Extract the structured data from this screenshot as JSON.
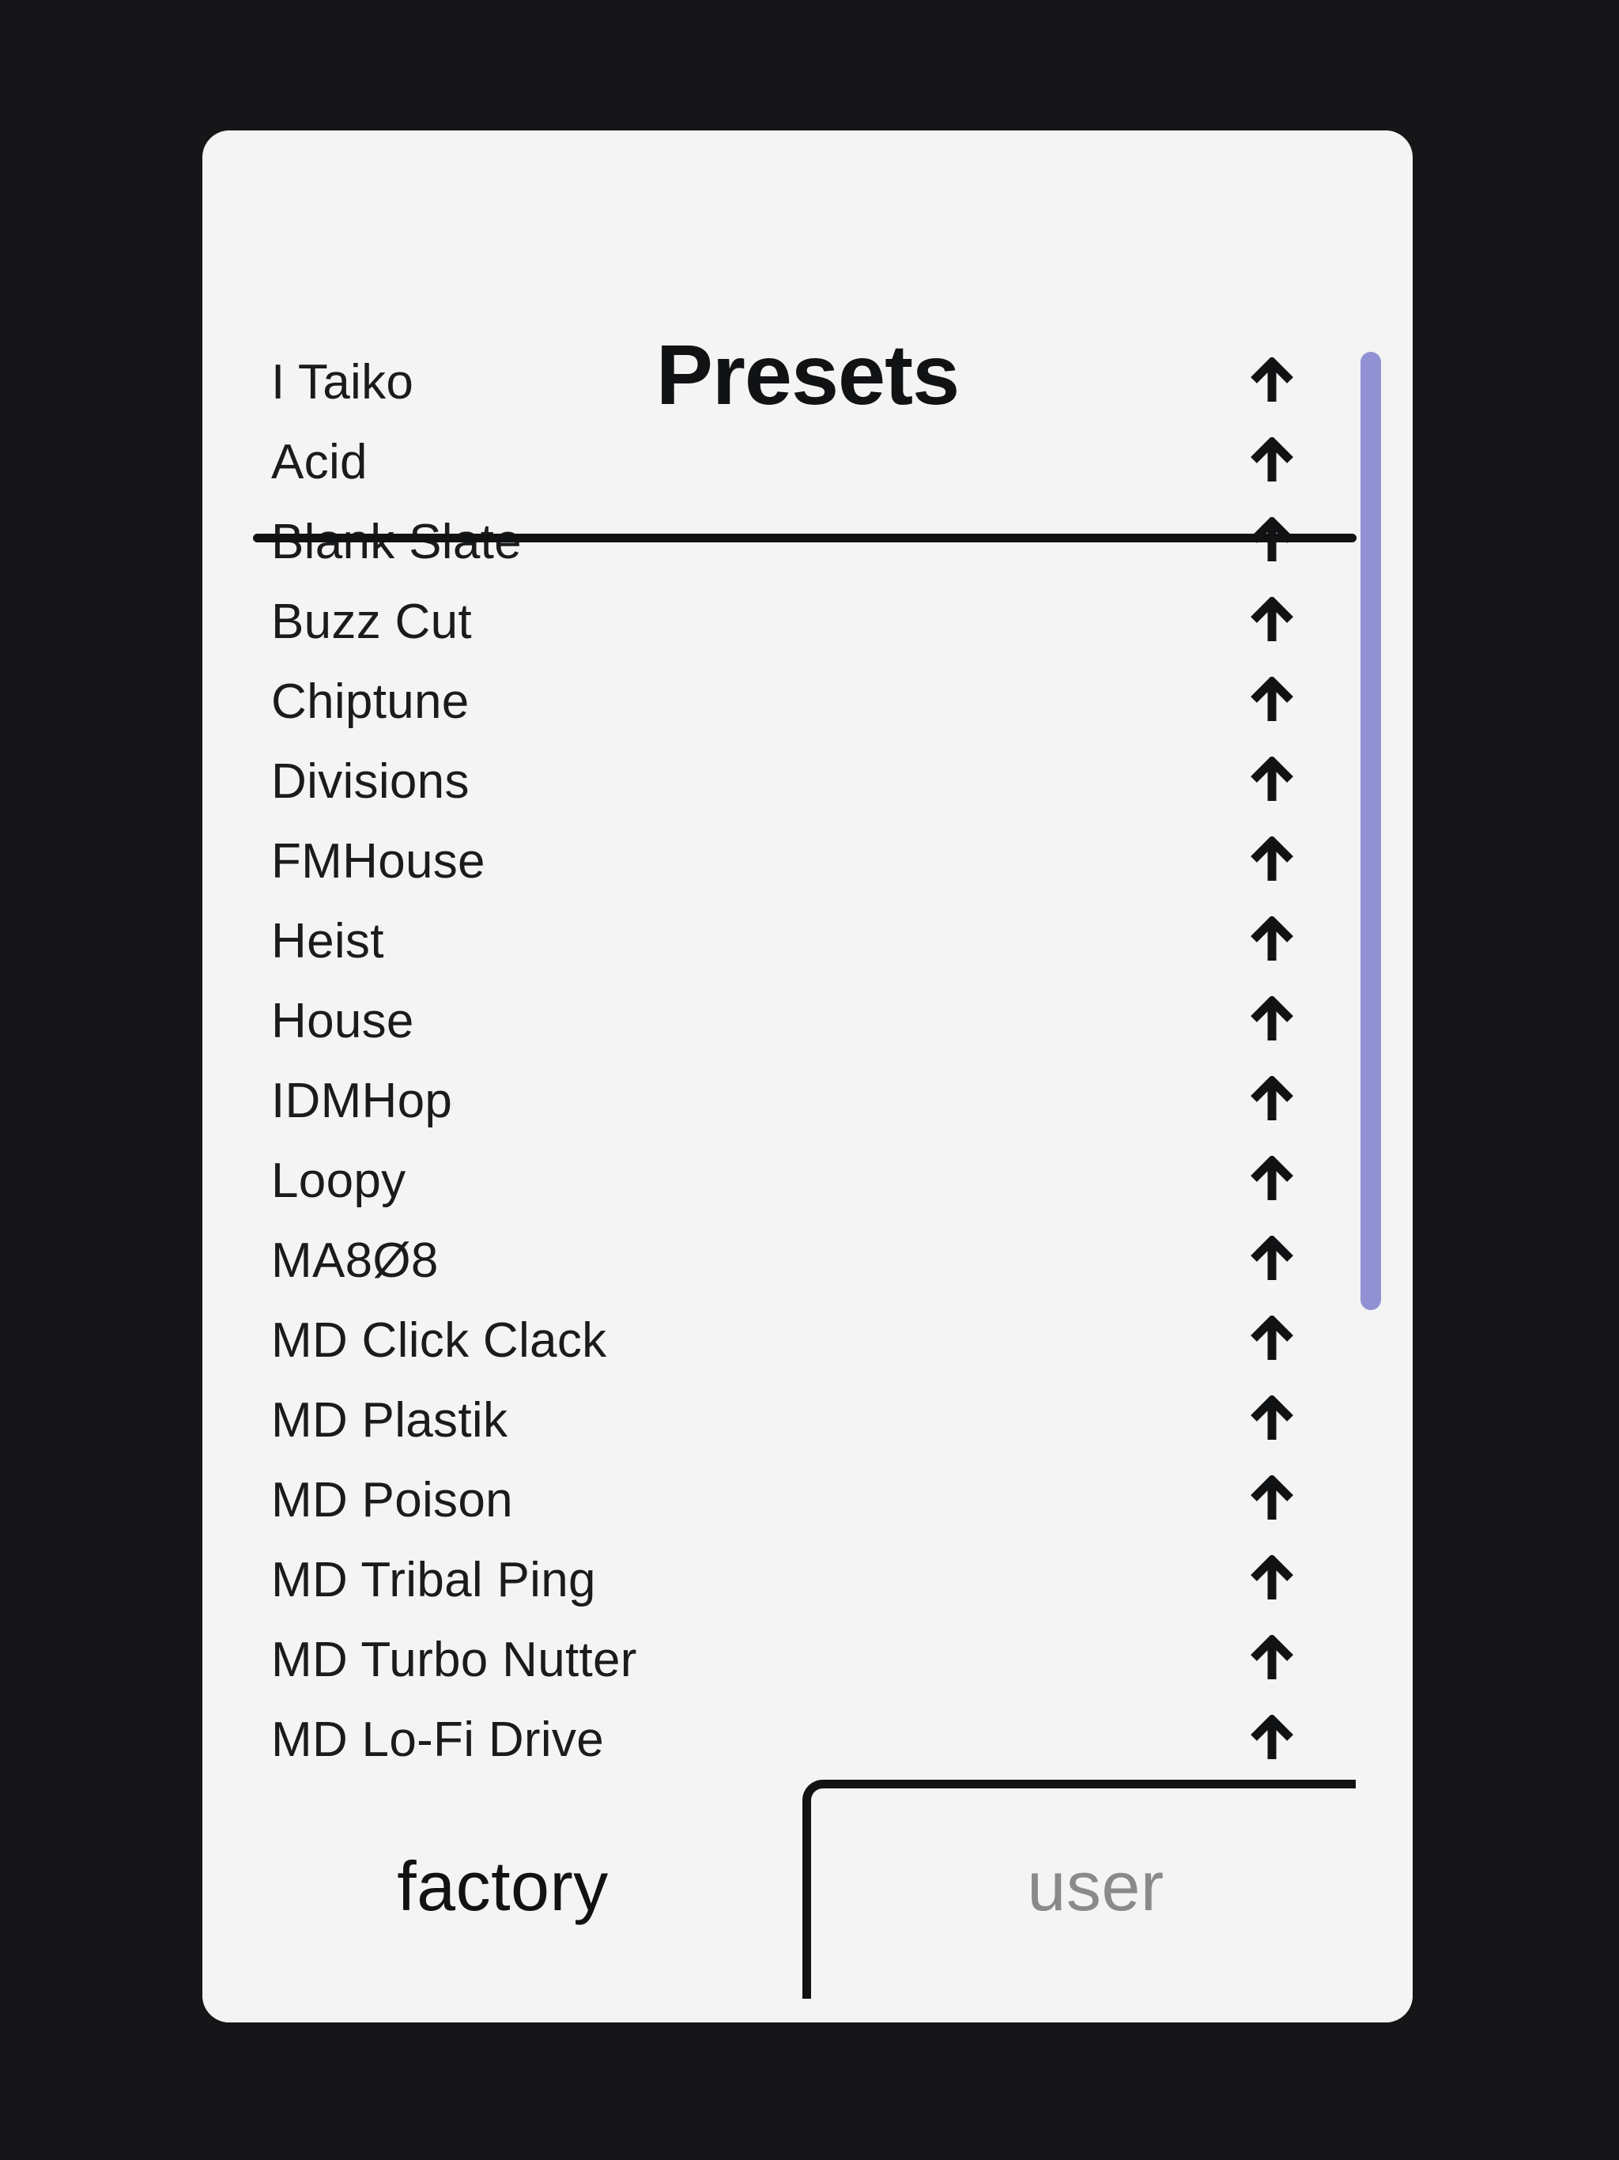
{
  "panel": {
    "title": "Presets",
    "background_color": "#f4f4f5",
    "page_background_color": "#161618"
  },
  "list": {
    "row_action_icon": "up-arrow-icon",
    "items": [
      {
        "name": "I Taiko"
      },
      {
        "name": "Acid"
      },
      {
        "name": "Blank Slate"
      },
      {
        "name": "Buzz Cut"
      },
      {
        "name": "Chiptune"
      },
      {
        "name": "Divisions"
      },
      {
        "name": "FMHouse"
      },
      {
        "name": "Heist"
      },
      {
        "name": "House"
      },
      {
        "name": "IDMHop"
      },
      {
        "name": "Loopy"
      },
      {
        "name": "MA8Ø8"
      },
      {
        "name": "MD Click Clack"
      },
      {
        "name": "MD Plastik"
      },
      {
        "name": "MD Poison"
      },
      {
        "name": "MD Tribal Ping"
      },
      {
        "name": "MD Turbo Nutter"
      },
      {
        "name": "MD Lo-Fi Drive"
      }
    ]
  },
  "scrollbar": {
    "color": "#9191d4",
    "orientation": "vertical"
  },
  "tabs": {
    "items": [
      {
        "label": "factory",
        "active": true,
        "color": "#111214"
      },
      {
        "label": "user",
        "active": false,
        "color": "#8a8a8a"
      }
    ]
  }
}
